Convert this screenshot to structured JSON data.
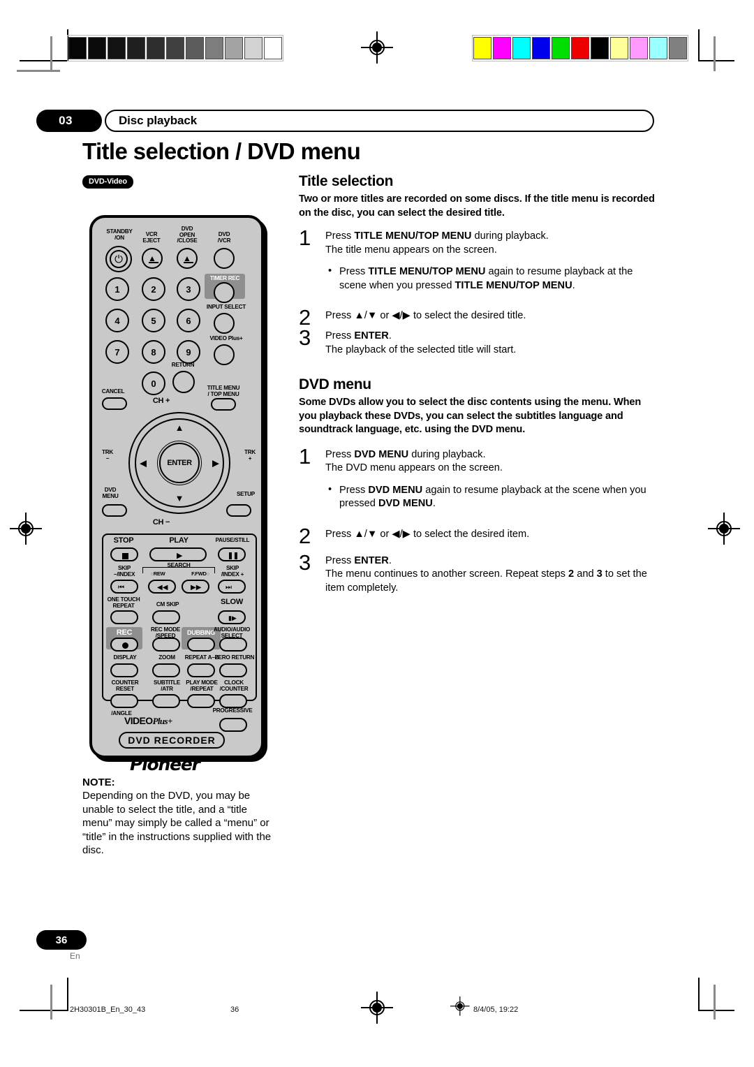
{
  "header": {
    "chapter_number": "03",
    "chapter_title": "Disc playback"
  },
  "page_title": "Title selection / DVD menu",
  "disc_badge": "DVD-Video",
  "sections": [
    {
      "heading": "Title selection",
      "lead": "Two or more titles are recorded on some discs. If the title menu is recorded on the disc, you can select the desired title.",
      "steps": [
        {
          "num": "1",
          "line1_pre": "Press ",
          "line1_bold": "TITLE MENU/TOP MENU",
          "line1_post": " during playback.",
          "line2": "The title menu appears on the screen.",
          "bullet_pre": "Press ",
          "bullet_bold1": "TITLE MENU/TOP MENU",
          "bullet_mid": " again to resume playback at the scene when you pressed ",
          "bullet_bold2": "TITLE MENU/TOP MENU",
          "bullet_post": "."
        },
        {
          "num": "2",
          "line1_pre": "Press ",
          "arrows": "▲/▼ or ◀/▶",
          "line1_post": " to select the desired title."
        },
        {
          "num": "3",
          "line1_pre": "Press ",
          "line1_bold": "ENTER",
          "line1_post": ".",
          "line2": "The playback of the selected title will start."
        }
      ]
    },
    {
      "heading": "DVD menu",
      "lead": "Some DVDs allow you to select the disc contents using the menu. When you playback these DVDs, you can select the subtitles language and soundtrack language, etc. using the DVD menu.",
      "steps": [
        {
          "num": "1",
          "line1_pre": "Press ",
          "line1_bold": "DVD MENU",
          "line1_post": " during playback.",
          "line2": "The DVD menu appears on the screen.",
          "bullet_pre": "Press ",
          "bullet_bold1": "DVD MENU",
          "bullet_mid": " again to resume playback at the scene when you pressed ",
          "bullet_bold2": "DVD MENU",
          "bullet_post": "."
        },
        {
          "num": "2",
          "line1_pre": "Press ",
          "arrows": "▲/▼ or ◀/▶",
          "line1_post": " to select the desired item."
        },
        {
          "num": "3",
          "line1_pre": "Press ",
          "line1_bold": "ENTER",
          "line1_post": ".",
          "line2_pre": "The menu continues to another screen. Repeat steps ",
          "line2_b1": "2",
          "line2_mid": " and ",
          "line2_b2": "3",
          "line2_post": " to set the item completely."
        }
      ]
    }
  ],
  "note": {
    "label": "NOTE:",
    "body": "Depending on the DVD,  you may be unable to select the title, and a “title menu” may simply be called a “menu” or “title” in the instructions supplied with the disc."
  },
  "remote": {
    "labels": {
      "standby": "STANDBY\n/ON",
      "vcr_eject": "VCR\nEJECT",
      "dvd_open": "DVD\nOPEN\n/CLOSE",
      "dvd_vcr": "DVD\n/VCR",
      "timer_rec": "TIMER REC",
      "input_select": "INPUT SELECT",
      "video_plus": "VIDEO Plus+",
      "return": "RETURN",
      "cancel": "CANCEL",
      "title_menu": "TITLE MENU\n/ TOP MENU",
      "ch_plus": "CH +",
      "ch_minus": "CH −",
      "trk_minus": "TRK\n−",
      "trk_plus": "TRK\n+",
      "dvd_menu": "DVD\nMENU",
      "setup": "SETUP",
      "enter": "ENTER",
      "stop": "STOP",
      "play": "PLAY",
      "pause_still": "PAUSE/STILL",
      "skip_index_minus": "SKIP\n−/INDEX",
      "search": "SEARCH",
      "rew": "REW",
      "ffwd": "F.FWD",
      "skip_index_plus": "SKIP\n/INDEX +",
      "one_touch_repeat": "ONE TOUCH\nREPEAT",
      "cm_skip": "CM SKIP",
      "slow": "SLOW",
      "rec": "REC",
      "rec_mode": "REC MODE\n/SPEED",
      "dubbing": "DUBBING",
      "audio_select": "AUDIO/AUDIO\nSELECT",
      "display": "DISPLAY",
      "zoom": "ZOOM",
      "repeat_ab": "REPEAT A–B",
      "zero_return": "ZERO RETURN",
      "counter_reset": "COUNTER\nRESET",
      "subtitle": "SUBTITLE\n/ATR",
      "play_mode": "PLAY MODE\n/REPEAT",
      "clock_counter": "CLOCK\n/COUNTER",
      "angle": "/ANGLE",
      "progressive": "PROGRESSIVE",
      "videoplus_logo_a": "VIDEO",
      "videoplus_logo_b": "Plus+",
      "dvd_recorder": "DVD RECORDER",
      "brand": "Pioneer"
    },
    "numbers": [
      "1",
      "2",
      "3",
      "4",
      "5",
      "6",
      "7",
      "8",
      "9",
      "0"
    ]
  },
  "footer": {
    "page_number": "36",
    "language": "En",
    "file_id": "2H30301B_En_30_43",
    "page_ref": "36",
    "timestamp": "8/4/05, 19:22"
  },
  "print_marks": {
    "grayscale": [
      "#050505",
      "#0b0b0b",
      "#131313",
      "#1f1f1f",
      "#2e2e2e",
      "#404040",
      "#5c5c5c",
      "#7d7d7d",
      "#a3a3a3",
      "#d2d2d2",
      "#ffffff"
    ],
    "colors": [
      "#ffff00",
      "#ff00ff",
      "#00ffff",
      "#0000ee",
      "#00dd00",
      "#ee0000",
      "#000000",
      "#ffff99",
      "#ff99ff",
      "#99ffff",
      "#808080"
    ]
  }
}
